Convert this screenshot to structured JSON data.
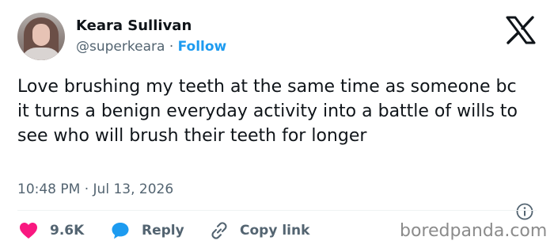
{
  "user": {
    "name": "Keara Sullivan",
    "handle": "@superkeara",
    "separator": "·",
    "follow_label": "Follow"
  },
  "tweet": {
    "text": "Love brushing my teeth at the same time as someone bc it turns a benign everyday activity into a battle of wills to see who will brush their teeth for longer",
    "timestamp": "10:48 PM · Jul 13, 2026"
  },
  "actions": {
    "likes": "9.6K",
    "reply_label": "Reply",
    "copy_label": "Copy link"
  },
  "watermark": "boredpanda.com",
  "icons": {
    "like": "heart-icon",
    "reply": "speech-bubble-icon",
    "copy": "link-icon",
    "brand": "x-logo-icon",
    "info": "info-icon"
  },
  "colors": {
    "text": "#0f1419",
    "muted": "#536471",
    "accent": "#1d9bf0",
    "like": "#f91880",
    "watermark": "#8b8b8b"
  }
}
